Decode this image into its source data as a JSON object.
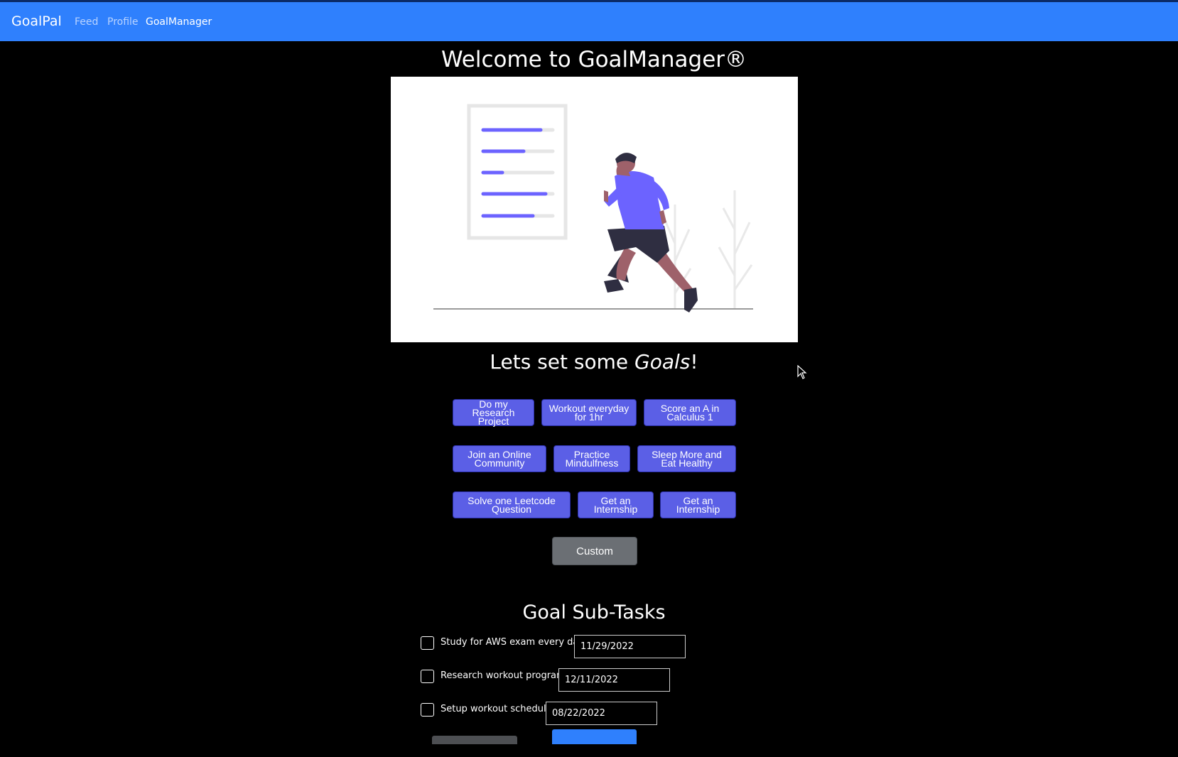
{
  "navbar": {
    "brand": "GoalPal",
    "links": [
      "Feed",
      "Profile",
      "GoalManager"
    ]
  },
  "main": {
    "title": "Welcome to GoalManager®",
    "subtitle_pre": "Lets set some ",
    "subtitle_em": "Goals",
    "subtitle_post": "!"
  },
  "goal_buttons": [
    "Do my Research Project",
    "Workout everyday for 1hr",
    "Score an A in Calculus 1",
    "Join an Online Community",
    "Practice Mindulfness",
    "Sleep More and Eat Healthy",
    "Solve one Leetcode Question",
    "Get an Internship",
    "Get an Internship"
  ],
  "custom_button": "Custom",
  "subtasks": {
    "title": "Goal Sub-Tasks",
    "items": [
      {
        "label": "Study for AWS exam every day",
        "date": "11/29/2022"
      },
      {
        "label": "Research workout program",
        "date": "12/11/2022"
      },
      {
        "label": "Setup workout schedule",
        "date": "08/22/2022"
      }
    ]
  },
  "colors": {
    "navbar": "#2f80fd",
    "goal_button": "#5b5fe6",
    "custom_button": "#6b6f74",
    "illustration_accent": "#6c63ff"
  },
  "icons": {
    "cursor": "mouse-pointer-icon"
  }
}
